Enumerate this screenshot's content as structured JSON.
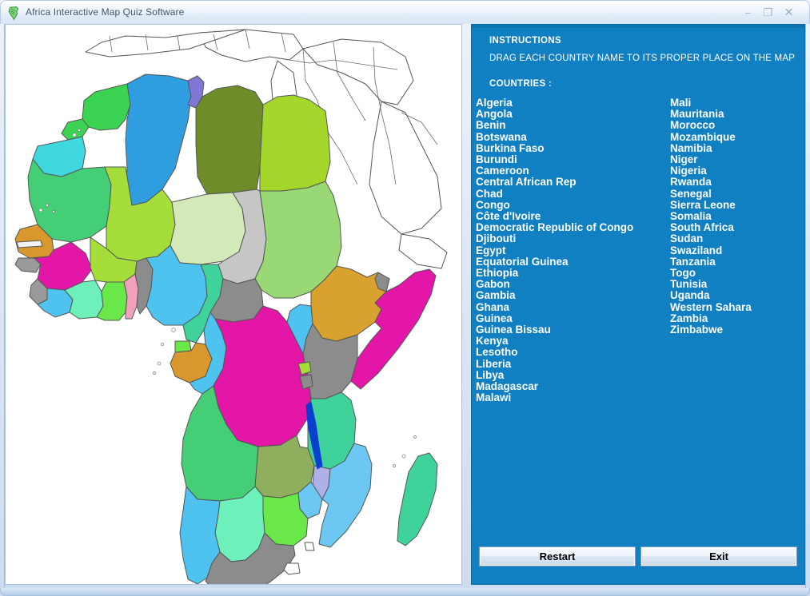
{
  "window": {
    "title": "Africa Interactive Map Quiz Software",
    "icon": "africa-continent-icon",
    "controls": {
      "minimize": "–",
      "maximize": "❐",
      "close": "✕"
    }
  },
  "quiz_panel": {
    "instructions_label": "INSTRUCTIONS",
    "instructions_text": "DRAG EACH COUNTRY NAME TO ITS PROPER PLACE ON THE MAP",
    "countries_label": "COUNTRIES :",
    "background_color": "#1080c2",
    "text_color": "#ffffff",
    "countries_column_1": [
      "Algeria",
      "Angola",
      "Benin",
      "Botswana",
      "Burkina Faso",
      "Burundi",
      "Cameroon",
      "Central African Rep",
      "Chad",
      "Congo",
      "Côte d'Ivoire",
      "Democratic Republic of Congo",
      "Djibouti",
      "Egypt",
      "Equatorial Guinea",
      "Ethiopia",
      "Gabon",
      "Gambia",
      "Ghana",
      "Guinea",
      "Guinea Bissau",
      "Kenya",
      "Lesotho",
      "Liberia",
      "Libya",
      "Madagascar",
      "Malawi"
    ],
    "countries_column_2": [
      "Mali",
      "Mauritania",
      "Morocco",
      "Mozambique",
      "Namibia",
      "Niger",
      "Nigeria",
      "Rwanda",
      "Senegal",
      "Sierra Leone",
      "Somalia",
      "South Africa",
      "Sudan",
      "Swaziland",
      "Tanzania",
      "Togo",
      "Tunisia",
      "Uganda",
      "Western Sahara",
      "Zambia",
      "Zimbabwe"
    ]
  },
  "buttons": {
    "restart": "Restart",
    "exit": "Exit"
  },
  "map": {
    "background_color": "#ffffff",
    "border_color": "#555555",
    "regions": [
      {
        "name": "morocco",
        "color": "#3bd352"
      },
      {
        "name": "western-sahara",
        "color": "#3fd8e0"
      },
      {
        "name": "algeria",
        "color": "#2e9ee0"
      },
      {
        "name": "tunisia",
        "color": "#7f78d6"
      },
      {
        "name": "libya",
        "color": "#6e8c2a"
      },
      {
        "name": "egypt",
        "color": "#a4d62b"
      },
      {
        "name": "mauritania",
        "color": "#44cf77"
      },
      {
        "name": "mali",
        "color": "#a5de3a"
      },
      {
        "name": "niger",
        "color": "#d4e9b8"
      },
      {
        "name": "chad",
        "color": "#c6c6c6"
      },
      {
        "name": "sudan",
        "color": "#99d975"
      },
      {
        "name": "senegal",
        "color": "#d9982e"
      },
      {
        "name": "gambia",
        "color": "#f2f2f2"
      },
      {
        "name": "guinea-bissau",
        "color": "#9a9a9a"
      },
      {
        "name": "guinea",
        "color": "#e316a8"
      },
      {
        "name": "sierra-leone",
        "color": "#9a9a9a"
      },
      {
        "name": "liberia",
        "color": "#4fc3f0"
      },
      {
        "name": "cote-divoire",
        "color": "#6ef0bb"
      },
      {
        "name": "burkina-faso",
        "color": "#a5de3a"
      },
      {
        "name": "ghana",
        "color": "#6ae84a"
      },
      {
        "name": "togo",
        "color": "#f2a0bd"
      },
      {
        "name": "benin",
        "color": "#8c8c8c"
      },
      {
        "name": "nigeria",
        "color": "#4fc3f0"
      },
      {
        "name": "cameroon",
        "color": "#3fd39b"
      },
      {
        "name": "central-african-rep",
        "color": "#8c8c8c"
      },
      {
        "name": "equatorial-guinea",
        "color": "#6ae84a"
      },
      {
        "name": "gabon",
        "color": "#d9982e"
      },
      {
        "name": "congo",
        "color": "#4fc3f0"
      },
      {
        "name": "democratic-republic-of-congo",
        "color": "#e316a8"
      },
      {
        "name": "ethiopia",
        "color": "#d9a12e"
      },
      {
        "name": "djibouti",
        "color": "#8c8c8c"
      },
      {
        "name": "somalia",
        "color": "#e316a8"
      },
      {
        "name": "kenya",
        "color": "#8c8c8c"
      },
      {
        "name": "uganda",
        "color": "#4fc3f0"
      },
      {
        "name": "rwanda",
        "color": "#a5de3a"
      },
      {
        "name": "burundi",
        "color": "#8c8c8c"
      },
      {
        "name": "tanzania",
        "color": "#3fd39b"
      },
      {
        "name": "angola",
        "color": "#44cf77"
      },
      {
        "name": "zambia",
        "color": "#8fae5e"
      },
      {
        "name": "malawi",
        "color": "#b0b0e8"
      },
      {
        "name": "mozambique",
        "color": "#6cc8f2"
      },
      {
        "name": "zimbabwe",
        "color": "#6ae84a"
      },
      {
        "name": "botswana",
        "color": "#6ef0bb"
      },
      {
        "name": "namibia",
        "color": "#4fc3f0"
      },
      {
        "name": "south-africa",
        "color": "#8c8c8c"
      },
      {
        "name": "lesotho",
        "color": "#ffffff"
      },
      {
        "name": "swaziland",
        "color": "#ffffff"
      },
      {
        "name": "madagascar",
        "color": "#3fd39b"
      },
      {
        "name": "lake-malawi",
        "color": "#0b3fd1"
      }
    ]
  }
}
